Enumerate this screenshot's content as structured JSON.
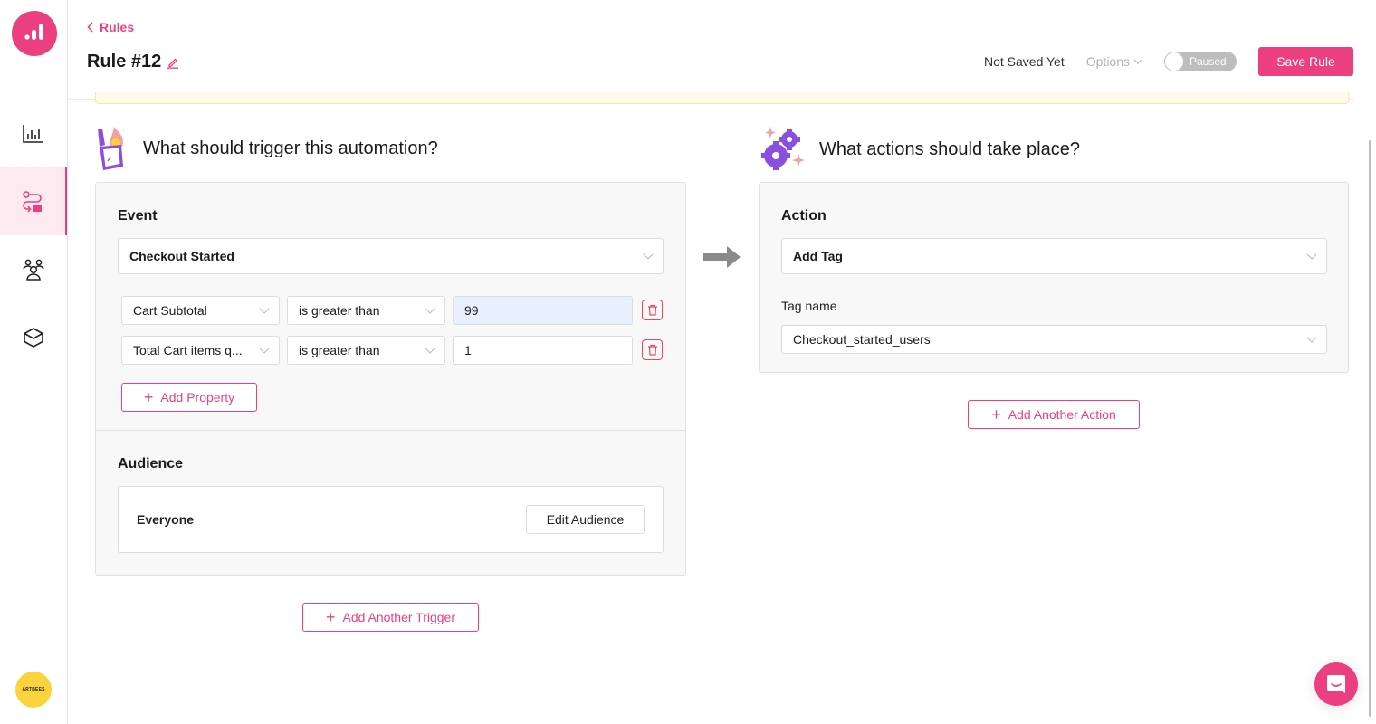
{
  "brand": {
    "accent": "#ec3f7f",
    "avatar_text": "ARTBEES"
  },
  "sidebar": {
    "items": [
      {
        "name": "analytics",
        "icon": "bar-chart-icon",
        "active": false
      },
      {
        "name": "automations",
        "icon": "workflow-icon",
        "active": true
      },
      {
        "name": "audiences",
        "icon": "users-icon",
        "active": false
      },
      {
        "name": "integrations",
        "icon": "cube-icon",
        "active": false
      }
    ]
  },
  "header": {
    "back_label": "Rules",
    "title": "Rule #12",
    "save_status": "Not Saved Yet",
    "options_label": "Options",
    "toggle_label": "Paused",
    "toggle_on": false,
    "save_label": "Save Rule"
  },
  "trigger": {
    "heading": "What should trigger this automation?",
    "event_label": "Event",
    "event_value": "Checkout Started",
    "conditions": [
      {
        "property": "Cart Subtotal",
        "operator": "is greater than",
        "value": "99"
      },
      {
        "property": "Total Cart items q...",
        "operator": "is greater than",
        "value": "1"
      }
    ],
    "add_property_label": "Add Property",
    "audience_label": "Audience",
    "audience_value": "Everyone",
    "edit_audience_label": "Edit Audience",
    "add_trigger_label": "Add Another Trigger"
  },
  "action": {
    "heading": "What actions should take place?",
    "action_label": "Action",
    "action_value": "Add Tag",
    "tag_label": "Tag name",
    "tag_value": "Checkout_started_users",
    "add_action_label": "Add Another Action"
  }
}
